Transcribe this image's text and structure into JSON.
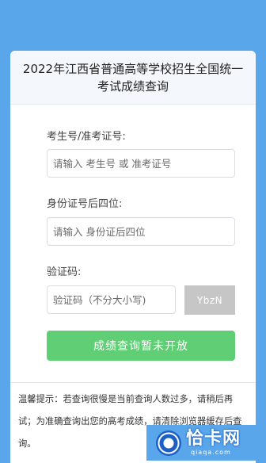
{
  "header": {
    "title": "2022年江西省普通高等学校招生全国统一考试成绩查询"
  },
  "form": {
    "exam_id_label": "考生号/准考证号:",
    "exam_id_placeholder": "请输入 考生号 或 准考证号",
    "id_last4_label": "身份证号后四位:",
    "id_last4_placeholder": "请输入 身份证后四位",
    "captcha_label": "验证码:",
    "captcha_placeholder": "验证码（不分大小写)",
    "captcha_image_text": "YbzN",
    "submit_label": "成绩查询暂未开放"
  },
  "notice": {
    "text": "温馨提示：若查询很慢是当前查询人数过多，请稍后再试；为准确查询出您的高考成绩，请清除浏览器缓存后查询。"
  },
  "watermark": {
    "name": "恰卡网",
    "domain": "qiaqa.com"
  },
  "colors": {
    "background": "#5aa6ea",
    "submit": "#5fce74",
    "captcha_bg": "#c6c6c6"
  }
}
